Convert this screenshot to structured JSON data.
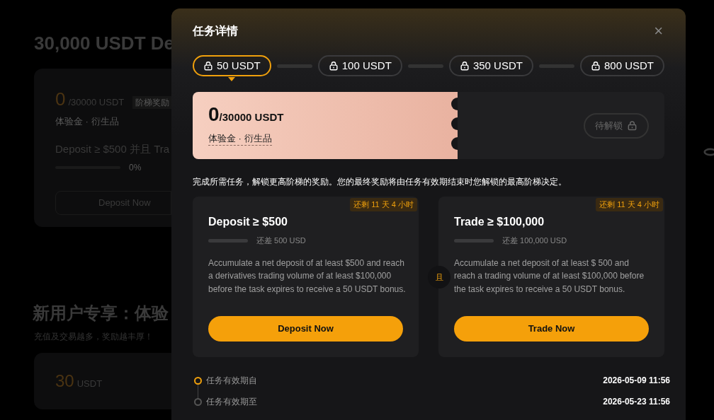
{
  "background": {
    "title": "30,000 USDT De",
    "card": {
      "amount": "0",
      "total": "/30000 USDT",
      "tag": "阶梯奖励",
      "tags": "体验金 · 衍生品",
      "task": "Deposit ≥ $500 并且 Tra",
      "level": 0,
      "progress": "0%",
      "button": "Deposit Now"
    },
    "section_title": "新用户专享：体验",
    "section_subtitle": "充值及交易越多，奖励越丰厚！",
    "card2": {
      "amount": "30",
      "unit": "USDT"
    }
  },
  "modal": {
    "title": "任务详情",
    "close": "×",
    "tiers": [
      {
        "label": "50 USDT",
        "selected": true
      },
      {
        "label": "100 USDT",
        "selected": false
      },
      {
        "label": "350 USDT",
        "selected": false
      },
      {
        "label": "800 USDT",
        "selected": false
      }
    ],
    "reward": {
      "amount": "0",
      "total": "/30000 USDT",
      "tags": "体验金 · 衍生品",
      "status": "待解锁"
    },
    "intro": "完成所需任务，解锁更高阶梯的奖励。您的最终奖励将由任务有效期结束时您解锁的最高阶梯决定。",
    "tasks": [
      {
        "title": "Deposit ≥ $500",
        "remaining": "还剩 11 天 4 小时",
        "level": 0,
        "gap": "还差 500 USD",
        "description": "Accumulate a net deposit of at least $500 and reach a derivatives trading volume of at least $100,000 before the task expires to receive a 50 USDT bonus.",
        "button": "Deposit Now"
      },
      {
        "title": "Trade ≥ $100,000",
        "remaining": "还剩 11 天 4 小时",
        "level": 0,
        "gap": "还差 100,000 USD",
        "description": "Accumulate a net deposit of at least $ 500 and reach a trading volume of at least $100,000 before the task expires to receive a 50 USDT bonus.",
        "button": "Trade Now"
      }
    ],
    "connector": "且",
    "period": [
      {
        "label": "任务有效期自",
        "value": "2026-05-09 11:56",
        "active": true
      },
      {
        "label": "任务有效期至",
        "value": "2026-05-23 11:56",
        "active": false
      }
    ]
  }
}
